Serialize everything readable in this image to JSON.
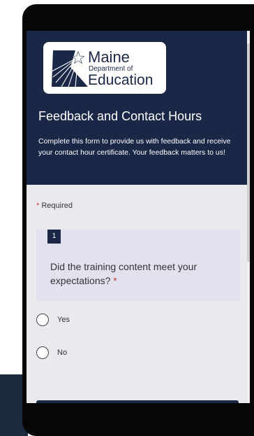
{
  "header": {
    "logo": {
      "line1": "Maine",
      "line2": "Department of",
      "line3": "Education"
    },
    "title": "Feedback and Contact Hours",
    "description": "Complete this form to provide us with feedback and receive your contact hour certificate.  Your feedback matters to us!"
  },
  "required_note": {
    "star": "*",
    "text": "Required"
  },
  "question": {
    "number": "1",
    "text": "Did the training content meet your expectations?",
    "star": "*",
    "options": [
      {
        "label": "Yes"
      },
      {
        "label": "No"
      }
    ]
  },
  "colors": {
    "header_bg": "#1b2746",
    "page_bg": "#eaeaee",
    "card_bg": "#e1e2ed",
    "required": "#c23b3b"
  }
}
